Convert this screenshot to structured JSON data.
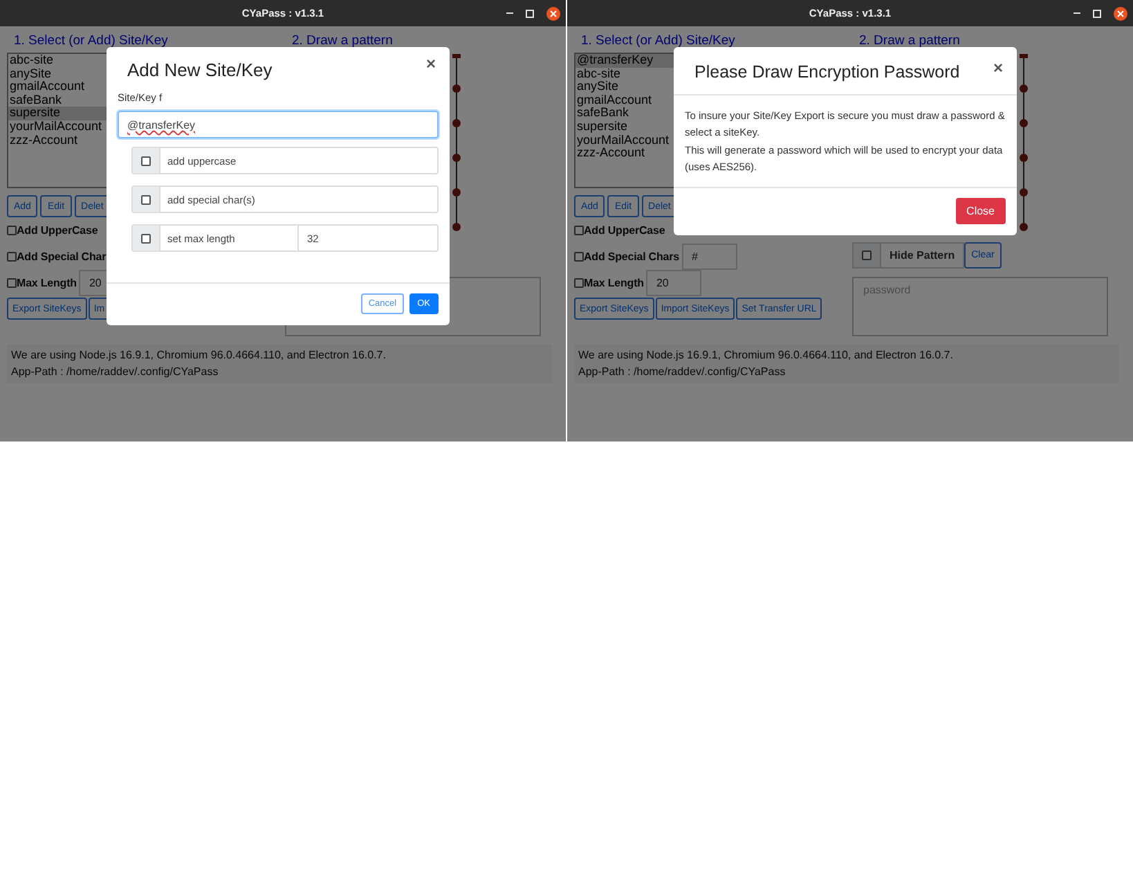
{
  "windows": [
    {
      "title": "CYaPass : v1.3.1",
      "site_heading": "1. Select (or Add) Site/Key",
      "pattern_heading": "2. Draw a pattern",
      "sites": [
        {
          "label": "abc-site",
          "selected": false
        },
        {
          "label": "anySite",
          "selected": false
        },
        {
          "label": "gmailAccount",
          "selected": false
        },
        {
          "label": "safeBank",
          "selected": false
        },
        {
          "label": "supersite",
          "selected": true
        },
        {
          "label": "yourMailAccount",
          "selected": false
        },
        {
          "label": "zzz-Account",
          "selected": false
        }
      ],
      "site_buttons": [
        "Add",
        "Edit",
        "Delet"
      ],
      "options": [
        {
          "label": "Add UpperCase",
          "checked": false
        },
        {
          "label": "Add Special Char",
          "checked": false
        },
        {
          "label": "Max Length",
          "checked": false,
          "value": "20"
        }
      ],
      "actions": [
        "Export SiteKeys",
        "Im"
      ],
      "info": [
        "We are using Node.js 16.9.1, Chromium 96.0.4664.110, and Electron 16.0.7.",
        "App-Path : /home/raddev/.config/CYaPass"
      ],
      "dialog": {
        "kind": "form",
        "title": "Add New Site/Key",
        "close": "×",
        "field_label": "Site/Key f",
        "field_value": "@transferKey",
        "options": [
          {
            "label": "add uppercase",
            "checked": false
          },
          {
            "label": "add special char(s)",
            "checked": false
          },
          {
            "label": "set max length",
            "checked": false,
            "value": "32"
          }
        ],
        "buttons": [
          {
            "label": "Cancel",
            "kind": "secondary"
          },
          {
            "label": "OK",
            "kind": "primary"
          }
        ]
      }
    },
    {
      "title": "CYaPass : v1.3.1",
      "site_heading": "1. Select (or Add) Site/Key",
      "pattern_heading": "2. Draw a pattern",
      "sites": [
        {
          "label": "@transferKey",
          "selected": true
        },
        {
          "label": "abc-site",
          "selected": false
        },
        {
          "label": "anySite",
          "selected": false
        },
        {
          "label": "gmailAccount",
          "selected": false
        },
        {
          "label": "safeBank",
          "selected": false
        },
        {
          "label": "supersite",
          "selected": false
        },
        {
          "label": "yourMailAccount",
          "selected": false
        },
        {
          "label": "zzz-Account",
          "selected": false
        }
      ],
      "site_buttons": [
        "Add",
        "Edit",
        "Delet"
      ],
      "options": [
        {
          "label": "Add UpperCase",
          "checked": false
        },
        {
          "label": "Add Special Chars",
          "checked": false,
          "value": "#"
        },
        {
          "label": "Max Length",
          "checked": false,
          "value": "20"
        }
      ],
      "actions": [
        "Export SiteKeys",
        "Import SiteKeys",
        "Set Transfer URL"
      ],
      "hide_pattern": {
        "label": "Hide Pattern",
        "checked": false
      },
      "clear_button": "Clear",
      "password": {
        "placeholder": "password"
      },
      "info": [
        "We are using Node.js 16.9.1, Chromium 96.0.4664.110, and Electron 16.0.7.",
        "App-Path : /home/raddev/.config/CYaPass"
      ],
      "dialog": {
        "kind": "message",
        "title": "Please Draw Encryption Password",
        "close": "×",
        "paragraphs": [
          "To insure your Site/Key Export is secure you must draw a password & select a siteKey.",
          "This will generate a password which will be used to encrypt your data (uses AES256)."
        ],
        "buttons": [
          {
            "label": "Close",
            "kind": "danger"
          }
        ]
      }
    }
  ]
}
